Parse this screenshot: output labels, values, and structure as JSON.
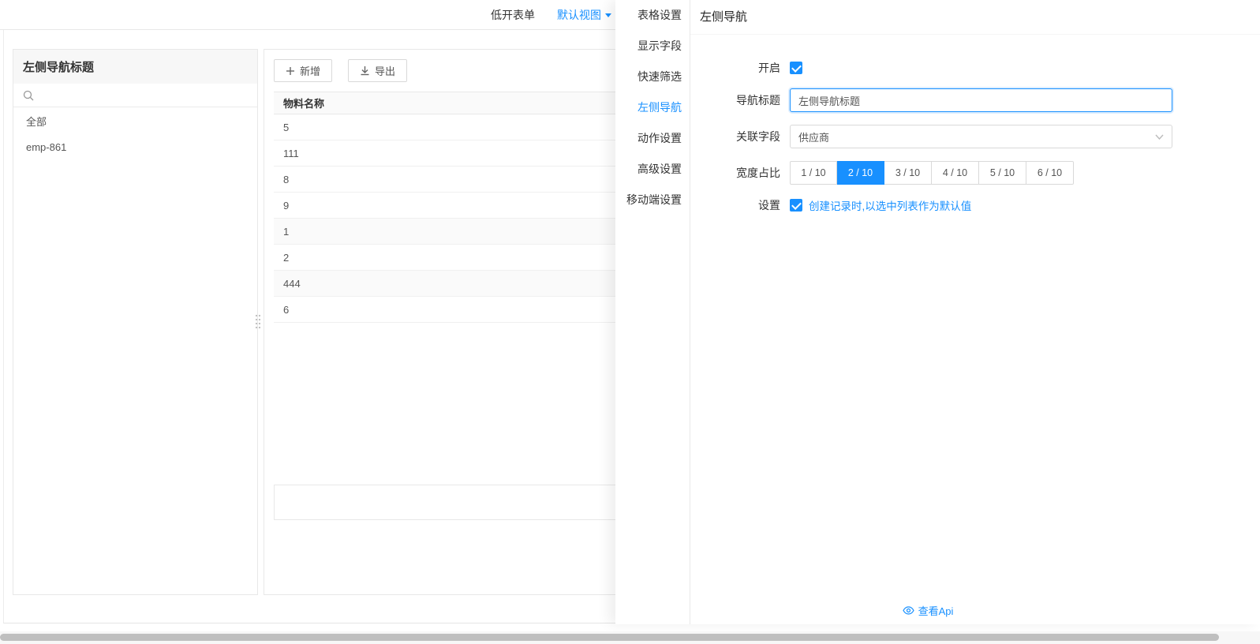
{
  "topbar": {
    "tab_form": "低开表单",
    "tab_view": "默认视图"
  },
  "left_panel": {
    "title": "左侧导航标题",
    "items": [
      "全部",
      "emp-861"
    ]
  },
  "table_panel": {
    "add_button": "新增",
    "export_button": "导出",
    "column_header": "物料名称",
    "rows": [
      "5",
      "111",
      "8",
      "9",
      "1",
      "2",
      "444",
      "6"
    ]
  },
  "drawer": {
    "menu": [
      "表格设置",
      "显示字段",
      "快速筛选",
      "左侧导航",
      "动作设置",
      "高级设置",
      "移动端设置"
    ],
    "active_menu": "左侧导航",
    "title": "左侧导航",
    "form": {
      "enable_label": "开启",
      "nav_title_label": "导航标题",
      "nav_title_value": "左侧导航标题",
      "related_field_label": "关联字段",
      "related_field_value": "供应商",
      "width_label": "宽度占比",
      "width_options": [
        "1 / 10",
        "2 / 10",
        "3 / 10",
        "4 / 10",
        "5 / 10",
        "6 / 10"
      ],
      "width_selected": "2 / 10",
      "settings_label": "设置",
      "settings_option": "创建记录时,以选中列表作为默认值"
    },
    "api_link": "查看Api"
  },
  "colors": {
    "accent": "#1890ff"
  }
}
